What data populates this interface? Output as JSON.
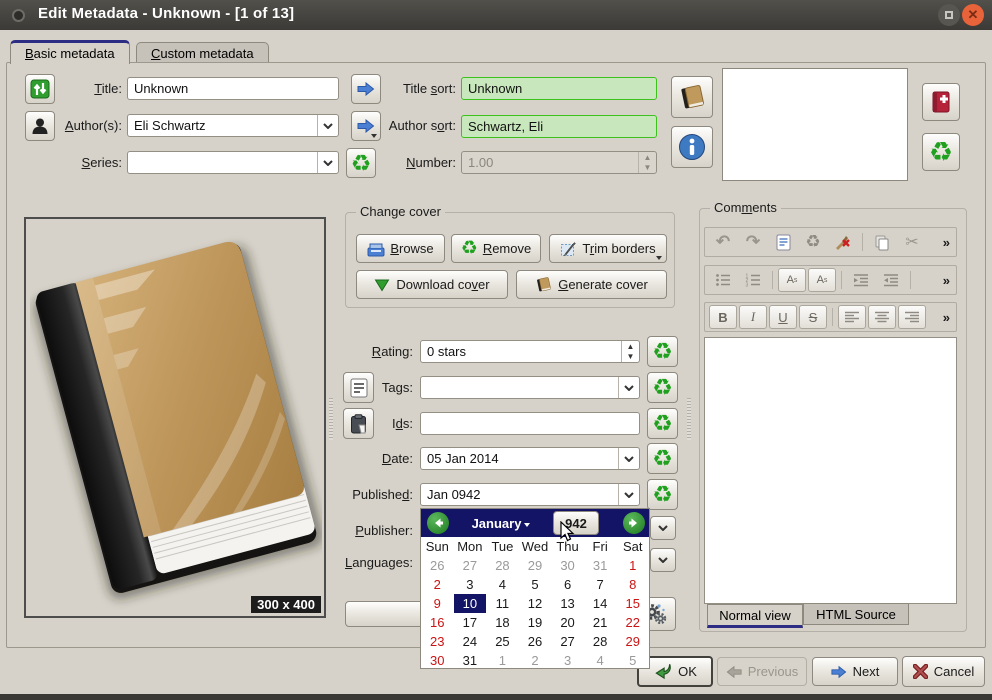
{
  "window": {
    "title": "Edit Metadata - Unknown -  [1 of 13]"
  },
  "tabs": {
    "basic": "Basic metadata",
    "custom": "Custom metadata"
  },
  "fields": {
    "title_label": "Title:",
    "title_value": "Unknown",
    "authors_label": "Author(s):",
    "authors_value": "Eli Schwartz",
    "series_label": "Series:",
    "series_value": "",
    "title_sort_label": "Title sort:",
    "title_sort_value": "Unknown",
    "author_sort_label": "Author sort:",
    "author_sort_value": "Schwartz, Eli",
    "number_label": "Number:",
    "number_value": "1.00",
    "rating_label": "Rating:",
    "rating_value": "0 stars",
    "tags_label": "Tags:",
    "tags_value": "",
    "ids_label": "Ids:",
    "ids_value": "",
    "date_label": "Date:",
    "date_value": "05 Jan 2014",
    "published_label": "Published:",
    "published_value": "Jan 0942",
    "publisher_label": "Publisher:",
    "languages_label": "Languages:"
  },
  "cover_panel": {
    "size_badge": "300 x 400"
  },
  "change_cover": {
    "group_label": "Change cover",
    "browse": "Browse",
    "remove": "Remove",
    "trim": "Trim borders",
    "download": "Download cover",
    "generate": "Generate cover"
  },
  "comments": {
    "group_label": "Comments",
    "bold": "B",
    "italic": "I",
    "underline": "U",
    "strike": "S",
    "chevron": "»",
    "undo": "↶",
    "redo": "↷",
    "recycle": "♻",
    "cut": "✂",
    "normal_tab": "Normal view",
    "html_tab": "HTML Source"
  },
  "calendar": {
    "month": "January",
    "year": "942",
    "day_names": [
      {
        "d": "Sun",
        "s": "wk"
      },
      {
        "d": "Mon",
        "s": ""
      },
      {
        "d": "Tue",
        "s": ""
      },
      {
        "d": "Wed",
        "s": ""
      },
      {
        "d": "Thu",
        "s": ""
      },
      {
        "d": "Fri",
        "s": ""
      },
      {
        "d": "Sat",
        "s": "wk"
      }
    ],
    "weeks": [
      [
        {
          "d": "26",
          "s": "out"
        },
        {
          "d": "27",
          "s": "out"
        },
        {
          "d": "28",
          "s": "out"
        },
        {
          "d": "29",
          "s": "out"
        },
        {
          "d": "30",
          "s": "out"
        },
        {
          "d": "31",
          "s": "out"
        },
        {
          "d": "1",
          "s": "wk"
        }
      ],
      [
        {
          "d": "2",
          "s": "wk"
        },
        {
          "d": "3",
          "s": ""
        },
        {
          "d": "4",
          "s": ""
        },
        {
          "d": "5",
          "s": ""
        },
        {
          "d": "6",
          "s": ""
        },
        {
          "d": "7",
          "s": ""
        },
        {
          "d": "8",
          "s": "wk"
        }
      ],
      [
        {
          "d": "9",
          "s": "wk"
        },
        {
          "d": "10",
          "s": "sel"
        },
        {
          "d": "11",
          "s": ""
        },
        {
          "d": "12",
          "s": ""
        },
        {
          "d": "13",
          "s": ""
        },
        {
          "d": "14",
          "s": ""
        },
        {
          "d": "15",
          "s": "wk"
        }
      ],
      [
        {
          "d": "16",
          "s": "wk"
        },
        {
          "d": "17",
          "s": ""
        },
        {
          "d": "18",
          "s": ""
        },
        {
          "d": "19",
          "s": ""
        },
        {
          "d": "20",
          "s": ""
        },
        {
          "d": "21",
          "s": ""
        },
        {
          "d": "22",
          "s": "wk"
        }
      ],
      [
        {
          "d": "23",
          "s": "wk"
        },
        {
          "d": "24",
          "s": ""
        },
        {
          "d": "25",
          "s": ""
        },
        {
          "d": "26",
          "s": ""
        },
        {
          "d": "27",
          "s": ""
        },
        {
          "d": "28",
          "s": ""
        },
        {
          "d": "29",
          "s": "wk"
        }
      ],
      [
        {
          "d": "30",
          "s": "wk"
        },
        {
          "d": "31",
          "s": ""
        },
        {
          "d": "1",
          "s": "out"
        },
        {
          "d": "2",
          "s": "out"
        },
        {
          "d": "3",
          "s": "out"
        },
        {
          "d": "4",
          "s": "out"
        },
        {
          "d": "5",
          "s": "out"
        }
      ]
    ]
  },
  "footer": {
    "ok": "OK",
    "previous": "Previous",
    "next": "Next",
    "cancel": "Cancel"
  },
  "recycle_glyph": "♻",
  "gear_glyph": "⚙"
}
